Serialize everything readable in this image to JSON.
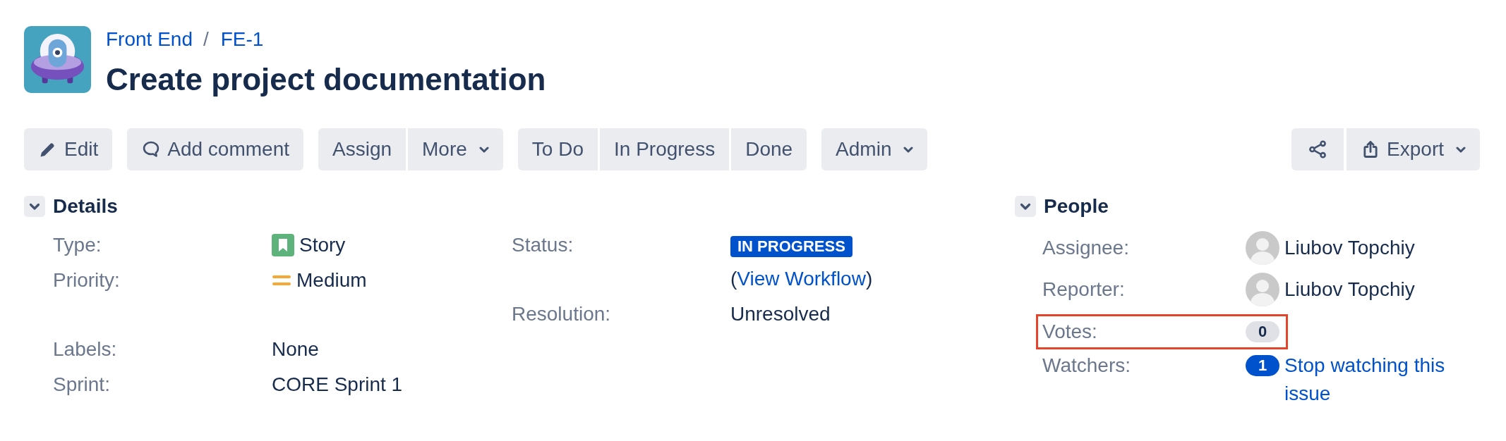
{
  "breadcrumbs": [
    {
      "label": "Front End"
    },
    {
      "label": "FE-1"
    }
  ],
  "breadcrumb_separator": "/",
  "title": "Create project documentation",
  "toolbar": {
    "left_groups": [
      [
        {
          "kind": "edit",
          "label": "Edit",
          "dropdown": false
        }
      ],
      [
        {
          "kind": "comment",
          "label": "Add comment",
          "dropdown": false
        }
      ],
      [
        {
          "kind": "plain",
          "label": "Assign",
          "dropdown": false
        },
        {
          "kind": "plain",
          "label": "More",
          "dropdown": true
        }
      ],
      [
        {
          "kind": "plain",
          "label": "To Do",
          "dropdown": false
        },
        {
          "kind": "plain",
          "label": "In Progress",
          "dropdown": false
        },
        {
          "kind": "plain",
          "label": "Done",
          "dropdown": false
        }
      ],
      [
        {
          "kind": "plain",
          "label": "Admin",
          "dropdown": true
        }
      ]
    ],
    "right_groups": [
      [
        {
          "kind": "share",
          "dropdown": false
        },
        {
          "kind": "export",
          "label": "Export",
          "dropdown": true
        }
      ]
    ]
  },
  "details": {
    "heading": "Details",
    "expanded": true,
    "columns": [
      [
        {
          "label": "Type:",
          "kind": "story",
          "value": "Story"
        },
        {
          "label": "Priority:",
          "kind": "priority-medium",
          "value": "Medium"
        }
      ],
      [
        {
          "label": "Status:",
          "kind": "status",
          "value": "IN PROGRESS",
          "link_before": "(",
          "link": "View Workflow",
          "link_after": ")"
        },
        {
          "label": "Resolution:",
          "kind": "text",
          "value": "Unresolved"
        }
      ]
    ],
    "custom_fields": [
      {
        "label": "Labels:",
        "kind": "text",
        "value": "None"
      },
      {
        "label": "Sprint:",
        "kind": "text",
        "value": "CORE Sprint 1"
      }
    ]
  },
  "people": {
    "heading": "People",
    "expanded": true,
    "fields": [
      {
        "label": "Assignee:",
        "kind": "user",
        "value": "Liubov Topchiy",
        "highlighted": false
      },
      {
        "label": "Reporter:",
        "kind": "user",
        "value": "Liubov Topchiy",
        "highlighted": false
      },
      {
        "label": "Votes:",
        "kind": "votes",
        "value": "0",
        "active": false,
        "highlighted": true
      },
      {
        "label": "Watchers:",
        "kind": "watchers",
        "value": "1",
        "active": true,
        "link": "Stop watching this issue",
        "highlighted": false
      }
    ]
  }
}
